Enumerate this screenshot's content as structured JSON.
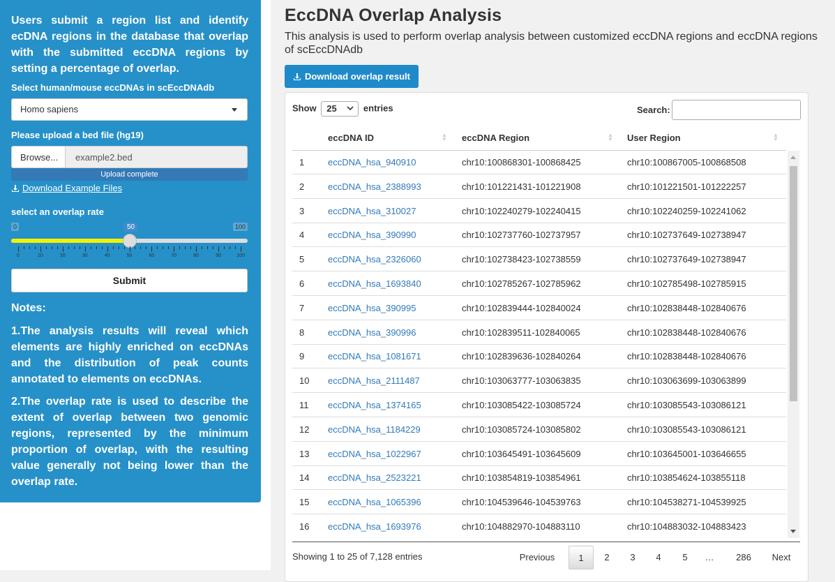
{
  "sidebar": {
    "intro": "Users submit a region list and identify ecDNA regions in the database that overlap with the submitted eccDNA regions by setting a percentage of overlap.",
    "species_label": "Select human/mouse eccDNAs in scEccDNAdb",
    "species_value": "Homo sapiens",
    "upload_label": "Please upload a bed file (hg19)",
    "browse_label": "Browse...",
    "file_name": "example2.bed",
    "upload_status": "Upload complete",
    "download_example_label": "Download Example Files",
    "slider_label": "select an overlap rate",
    "slider_min": "0",
    "slider_max": "100",
    "slider_value": "50",
    "slider_fraction": 0.5,
    "slider_ticks": [
      "0",
      "10",
      "20",
      "30",
      "40",
      "50",
      "60",
      "70",
      "80",
      "90",
      "100"
    ],
    "submit_label": "Submit",
    "notes_title": "Notes:",
    "note1": "1.The analysis results will reveal which elements are highly enriched on eccDNAs and the distribution of peak counts annotated to elements on eccDNAs.",
    "note2": "2.The overlap rate is used to describe the extent of overlap between two genomic regions, represented by the minimum proportion of overlap, with the resulting value generally not being lower than the overlap rate."
  },
  "main": {
    "title": "EccDNA Overlap Analysis",
    "description": "This analysis is used to perform overlap analysis between customized eccDNA regions and eccDNA regions of scEccDNAdb",
    "download_button": "Download overlap result"
  },
  "table": {
    "show_label": "Show",
    "length_value": "25",
    "entries_label": "entries",
    "search_label": "Search:",
    "headers": [
      "eccDNA ID",
      "eccDNA Region",
      "User Region"
    ],
    "rows": [
      [
        "1",
        "eccDNA_hsa_940910",
        "chr10:100868301-100868425",
        "chr10:100867005-100868508"
      ],
      [
        "2",
        "eccDNA_hsa_2388993",
        "chr10:101221431-101221908",
        "chr10:101221501-101222257"
      ],
      [
        "3",
        "eccDNA_hsa_310027",
        "chr10:102240279-102240415",
        "chr10:102240259-102241062"
      ],
      [
        "4",
        "eccDNA_hsa_390990",
        "chr10:102737760-102737957",
        "chr10:102737649-102738947"
      ],
      [
        "5",
        "eccDNA_hsa_2326060",
        "chr10:102738423-102738559",
        "chr10:102737649-102738947"
      ],
      [
        "6",
        "eccDNA_hsa_1693840",
        "chr10:102785267-102785962",
        "chr10:102785498-102785915"
      ],
      [
        "7",
        "eccDNA_hsa_390995",
        "chr10:102839444-102840024",
        "chr10:102838448-102840676"
      ],
      [
        "8",
        "eccDNA_hsa_390996",
        "chr10:102839511-102840065",
        "chr10:102838448-102840676"
      ],
      [
        "9",
        "eccDNA_hsa_1081671",
        "chr10:102839636-102840264",
        "chr10:102838448-102840676"
      ],
      [
        "10",
        "eccDNA_hsa_2111487",
        "chr10:103063777-103063835",
        "chr10:103063699-103063899"
      ],
      [
        "11",
        "eccDNA_hsa_1374165",
        "chr10:103085422-103085724",
        "chr10:103085543-103086121"
      ],
      [
        "12",
        "eccDNA_hsa_1184229",
        "chr10:103085724-103085802",
        "chr10:103085543-103086121"
      ],
      [
        "13",
        "eccDNA_hsa_1022967",
        "chr10:103645491-103645609",
        "chr10:103645001-103646655"
      ],
      [
        "14",
        "eccDNA_hsa_2523221",
        "chr10:103854819-103854961",
        "chr10:103854624-103855118"
      ],
      [
        "15",
        "eccDNA_hsa_1065396",
        "chr10:104539646-104539763",
        "chr10:104538271-104539925"
      ],
      [
        "16",
        "eccDNA_hsa_1693976",
        "chr10:104882970-104883110",
        "chr10:104883032-104883423"
      ]
    ],
    "info": "Showing 1 to 25 of 7,128 entries",
    "pagination": {
      "previous": "Previous",
      "pages": [
        "1",
        "2",
        "3",
        "4",
        "5"
      ],
      "ellipsis": "…",
      "last": "286",
      "next": "Next"
    }
  },
  "colors": {
    "sidebar_bg": "#2690c9",
    "link": "#337ab7",
    "slider_fill": "#f2f200",
    "button_blue": "#1f8ac9"
  }
}
